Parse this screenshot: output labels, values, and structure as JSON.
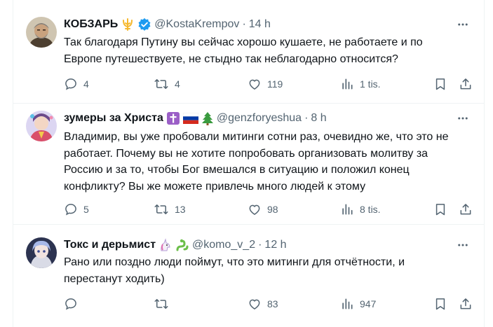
{
  "tweets": [
    {
      "name": "КОБЗАРЬ",
      "handle": "@KostaKrempov",
      "dot": "·",
      "time": "14 h",
      "text": "Так благодаря Путину вы сейчас хорошо кушаете, не работаете и по Европе путешествуете, не стыдно так неблагодарно относится?",
      "replies": "4",
      "reposts": "4",
      "likes": "119",
      "views": "1 tis.",
      "icons": [
        "trident-emoji",
        "verified-badge"
      ]
    },
    {
      "name": "зумеры за Христа",
      "handle": "@genzforyeshua",
      "dot": "·",
      "time": "8 h",
      "text": "Владимир, вы уже пробовали митинги сотни раз, очевидно же, что это не работает. Почему вы не хотите попробовать организовать молитву за Россию и за то, чтобы Бог вмешался в ситуацию и положил конец конфликту? Вы же можете привлечь много людей к этому",
      "replies": "5",
      "reposts": "13",
      "likes": "98",
      "views": "8 tis.",
      "icons": [
        "latin-cross-emoji",
        "russia-flag-emoji",
        "christmas-tree-emoji"
      ]
    },
    {
      "name": "Токс и дерьмист",
      "handle": "@komo_v_2",
      "dot": "·",
      "time": "12 h",
      "text": "Рано или поздно люди поймут, что это митинги для отчётности, и перестанут ходить)",
      "replies": "",
      "reposts": "",
      "likes": "83",
      "views": "947",
      "icons": [
        "unicorn-emoji",
        "snake-emoji"
      ]
    }
  ],
  "colors": {
    "text": "#0f1419",
    "secondary": "#536471",
    "verified": "#1d9bf0",
    "border": "#eff3f4"
  }
}
